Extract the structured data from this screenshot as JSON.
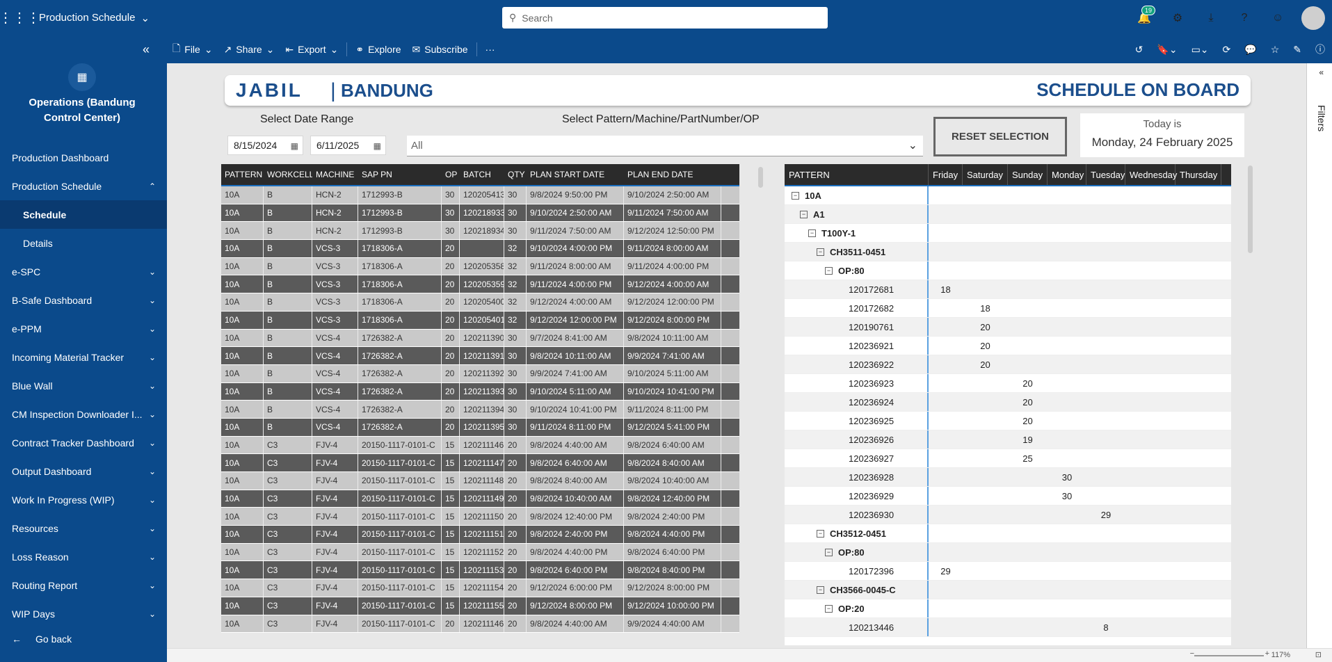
{
  "app": {
    "title": "Production Schedule",
    "search_placeholder": "Search",
    "notification_count": "19"
  },
  "sidebar": {
    "workspace_name": "Operations (Bandung Control Center)",
    "items": [
      {
        "label": "Production Dashboard",
        "chevron": false,
        "sub": false,
        "active": false
      },
      {
        "label": "Production Schedule",
        "chevron": true,
        "sub": false,
        "active": false,
        "expanded": true
      },
      {
        "label": "Schedule",
        "chevron": false,
        "sub": true,
        "active": true
      },
      {
        "label": "Details",
        "chevron": false,
        "sub": true,
        "active": false
      },
      {
        "label": "e-SPC",
        "chevron": true,
        "sub": false,
        "active": false
      },
      {
        "label": "B-Safe Dashboard",
        "chevron": true,
        "sub": false,
        "active": false
      },
      {
        "label": "e-PPM",
        "chevron": true,
        "sub": false,
        "active": false
      },
      {
        "label": "Incoming Material Tracker",
        "chevron": true,
        "sub": false,
        "active": false
      },
      {
        "label": "Blue Wall",
        "chevron": true,
        "sub": false,
        "active": false
      },
      {
        "label": "CM Inspection Downloader I...",
        "chevron": true,
        "sub": false,
        "active": false
      },
      {
        "label": "Contract Tracker Dashboard",
        "chevron": true,
        "sub": false,
        "active": false
      },
      {
        "label": "Output Dashboard",
        "chevron": true,
        "sub": false,
        "active": false
      },
      {
        "label": "Work In Progress (WIP)",
        "chevron": true,
        "sub": false,
        "active": false
      },
      {
        "label": "Resources",
        "chevron": true,
        "sub": false,
        "active": false
      },
      {
        "label": "Loss Reason",
        "chevron": true,
        "sub": false,
        "active": false
      },
      {
        "label": "Routing Report",
        "chevron": true,
        "sub": false,
        "active": false
      },
      {
        "label": "WIP Days",
        "chevron": true,
        "sub": false,
        "active": false
      }
    ],
    "go_back": "Go back"
  },
  "toolbar": {
    "file": "File",
    "share": "Share",
    "export": "Export",
    "explore": "Explore",
    "subscribe": "Subscribe",
    "more": "···"
  },
  "report": {
    "brand_left": "JABIL",
    "brand_right": "BANDUNG",
    "title": "SCHEDULE ON BOARD",
    "date_range_label": "Select Date Range",
    "date_from": "8/15/2024",
    "date_to": "6/11/2025",
    "filter_label": "Select Pattern/Machine/PartNumber/OP",
    "filter_value": "All",
    "reset_label": "RESET SELECTION",
    "today_label": "Today is",
    "today_value": "Monday, 24 February 2025",
    "filters_pane": "Filters",
    "zoom": "117%"
  },
  "schedule_table": {
    "columns": [
      "PATTERN",
      "WORKCELL",
      "MACHINE",
      "SAP PN",
      "OP",
      "BATCH",
      "QTY",
      "PLAN START DATE",
      "PLAN END DATE"
    ],
    "rows": [
      [
        "10A",
        "B",
        "HCN-2",
        "1712993-B",
        "30",
        "120205413",
        "30",
        "9/8/2024 9:50:00 PM",
        "9/10/2024 2:50:00 AM"
      ],
      [
        "10A",
        "B",
        "HCN-2",
        "1712993-B",
        "30",
        "120218933",
        "30",
        "9/10/2024 2:50:00 AM",
        "9/11/2024 7:50:00 AM"
      ],
      [
        "10A",
        "B",
        "HCN-2",
        "1712993-B",
        "30",
        "120218934",
        "30",
        "9/11/2024 7:50:00 AM",
        "9/12/2024 12:50:00 PM"
      ],
      [
        "10A",
        "B",
        "VCS-3",
        "1718306-A",
        "20",
        "",
        "32",
        "9/10/2024 4:00:00 PM",
        "9/11/2024 8:00:00 AM"
      ],
      [
        "10A",
        "B",
        "VCS-3",
        "1718306-A",
        "20",
        "120205358",
        "32",
        "9/11/2024 8:00:00 AM",
        "9/11/2024 4:00:00 PM"
      ],
      [
        "10A",
        "B",
        "VCS-3",
        "1718306-A",
        "20",
        "120205359",
        "32",
        "9/11/2024 4:00:00 PM",
        "9/12/2024 4:00:00 AM"
      ],
      [
        "10A",
        "B",
        "VCS-3",
        "1718306-A",
        "20",
        "120205400",
        "32",
        "9/12/2024 4:00:00 AM",
        "9/12/2024 12:00:00 PM"
      ],
      [
        "10A",
        "B",
        "VCS-3",
        "1718306-A",
        "20",
        "120205401",
        "32",
        "9/12/2024 12:00:00 PM",
        "9/12/2024 8:00:00 PM"
      ],
      [
        "10A",
        "B",
        "VCS-4",
        "1726382-A",
        "20",
        "120211390",
        "30",
        "9/7/2024 8:41:00 AM",
        "9/8/2024 10:11:00 AM"
      ],
      [
        "10A",
        "B",
        "VCS-4",
        "1726382-A",
        "20",
        "120211391",
        "30",
        "9/8/2024 10:11:00 AM",
        "9/9/2024 7:41:00 AM"
      ],
      [
        "10A",
        "B",
        "VCS-4",
        "1726382-A",
        "20",
        "120211392",
        "30",
        "9/9/2024 7:41:00 AM",
        "9/10/2024 5:11:00 AM"
      ],
      [
        "10A",
        "B",
        "VCS-4",
        "1726382-A",
        "20",
        "120211393",
        "30",
        "9/10/2024 5:11:00 AM",
        "9/10/2024 10:41:00 PM"
      ],
      [
        "10A",
        "B",
        "VCS-4",
        "1726382-A",
        "20",
        "120211394",
        "30",
        "9/10/2024 10:41:00 PM",
        "9/11/2024 8:11:00 PM"
      ],
      [
        "10A",
        "B",
        "VCS-4",
        "1726382-A",
        "20",
        "120211395",
        "30",
        "9/11/2024 8:11:00 PM",
        "9/12/2024 5:41:00 PM"
      ],
      [
        "10A",
        "C3",
        "FJV-4",
        "20150-1117-0101-C",
        "15",
        "120211146",
        "20",
        "9/8/2024 4:40:00 AM",
        "9/8/2024 6:40:00 AM"
      ],
      [
        "10A",
        "C3",
        "FJV-4",
        "20150-1117-0101-C",
        "15",
        "120211147",
        "20",
        "9/8/2024 6:40:00 AM",
        "9/8/2024 8:40:00 AM"
      ],
      [
        "10A",
        "C3",
        "FJV-4",
        "20150-1117-0101-C",
        "15",
        "120211148",
        "20",
        "9/8/2024 8:40:00 AM",
        "9/8/2024 10:40:00 AM"
      ],
      [
        "10A",
        "C3",
        "FJV-4",
        "20150-1117-0101-C",
        "15",
        "120211149",
        "20",
        "9/8/2024 10:40:00 AM",
        "9/8/2024 12:40:00 PM"
      ],
      [
        "10A",
        "C3",
        "FJV-4",
        "20150-1117-0101-C",
        "15",
        "120211150",
        "20",
        "9/8/2024 12:40:00 PM",
        "9/8/2024 2:40:00 PM"
      ],
      [
        "10A",
        "C3",
        "FJV-4",
        "20150-1117-0101-C",
        "15",
        "120211151",
        "20",
        "9/8/2024 2:40:00 PM",
        "9/8/2024 4:40:00 PM"
      ],
      [
        "10A",
        "C3",
        "FJV-4",
        "20150-1117-0101-C",
        "15",
        "120211152",
        "20",
        "9/8/2024 4:40:00 PM",
        "9/8/2024 6:40:00 PM"
      ],
      [
        "10A",
        "C3",
        "FJV-4",
        "20150-1117-0101-C",
        "15",
        "120211153",
        "20",
        "9/8/2024 6:40:00 PM",
        "9/8/2024 8:40:00 PM"
      ],
      [
        "10A",
        "C3",
        "FJV-4",
        "20150-1117-0101-C",
        "15",
        "120211154",
        "20",
        "9/12/2024 6:00:00 PM",
        "9/12/2024 8:00:00 PM"
      ],
      [
        "10A",
        "C3",
        "FJV-4",
        "20150-1117-0101-C",
        "15",
        "120211155",
        "20",
        "9/12/2024 8:00:00 PM",
        "9/12/2024 10:00:00 PM"
      ],
      [
        "10A",
        "C3",
        "FJV-4",
        "20150-1117-0101-C",
        "20",
        "120211146",
        "20",
        "9/8/2024 4:40:00 AM",
        "9/9/2024 4:40:00 AM"
      ]
    ]
  },
  "matrix": {
    "columns": [
      "PATTERN",
      "Friday",
      "Saturday",
      "Sunday",
      "Monday",
      "Tuesday",
      "Wednesday",
      "Thursday"
    ],
    "rows": [
      {
        "label": "10A",
        "level": 0,
        "group": true,
        "values": [
          "",
          "",
          "",
          "",
          "",
          "",
          ""
        ]
      },
      {
        "label": "A1",
        "level": 1,
        "group": true,
        "values": [
          "",
          "",
          "",
          "",
          "",
          "",
          ""
        ]
      },
      {
        "label": "T100Y-1",
        "level": 2,
        "group": true,
        "values": [
          "",
          "",
          "",
          "",
          "",
          "",
          ""
        ]
      },
      {
        "label": "CH3511-0451",
        "level": 3,
        "group": true,
        "values": [
          "",
          "",
          "",
          "",
          "",
          "",
          ""
        ]
      },
      {
        "label": "OP:80",
        "level": 4,
        "group": true,
        "values": [
          "",
          "",
          "",
          "",
          "",
          "",
          ""
        ]
      },
      {
        "label": "120172681",
        "level": 5,
        "group": false,
        "values": [
          "18",
          "",
          "",
          "",
          "",
          "",
          ""
        ]
      },
      {
        "label": "120172682",
        "level": 5,
        "group": false,
        "values": [
          "",
          "18",
          "",
          "",
          "",
          "",
          ""
        ]
      },
      {
        "label": "120190761",
        "level": 5,
        "group": false,
        "values": [
          "",
          "20",
          "",
          "",
          "",
          "",
          ""
        ]
      },
      {
        "label": "120236921",
        "level": 5,
        "group": false,
        "values": [
          "",
          "20",
          "",
          "",
          "",
          "",
          ""
        ]
      },
      {
        "label": "120236922",
        "level": 5,
        "group": false,
        "values": [
          "",
          "20",
          "",
          "",
          "",
          "",
          ""
        ]
      },
      {
        "label": "120236923",
        "level": 5,
        "group": false,
        "values": [
          "",
          "",
          "20",
          "",
          "",
          "",
          ""
        ]
      },
      {
        "label": "120236924",
        "level": 5,
        "group": false,
        "values": [
          "",
          "",
          "20",
          "",
          "",
          "",
          ""
        ]
      },
      {
        "label": "120236925",
        "level": 5,
        "group": false,
        "values": [
          "",
          "",
          "20",
          "",
          "",
          "",
          ""
        ]
      },
      {
        "label": "120236926",
        "level": 5,
        "group": false,
        "values": [
          "",
          "",
          "19",
          "",
          "",
          "",
          ""
        ]
      },
      {
        "label": "120236927",
        "level": 5,
        "group": false,
        "values": [
          "",
          "",
          "25",
          "",
          "",
          "",
          ""
        ]
      },
      {
        "label": "120236928",
        "level": 5,
        "group": false,
        "values": [
          "",
          "",
          "",
          "30",
          "",
          "",
          ""
        ]
      },
      {
        "label": "120236929",
        "level": 5,
        "group": false,
        "values": [
          "",
          "",
          "",
          "30",
          "",
          "",
          ""
        ]
      },
      {
        "label": "120236930",
        "level": 5,
        "group": false,
        "values": [
          "",
          "",
          "",
          "",
          "29",
          "",
          ""
        ]
      },
      {
        "label": "CH3512-0451",
        "level": 3,
        "group": true,
        "values": [
          "",
          "",
          "",
          "",
          "",
          "",
          ""
        ]
      },
      {
        "label": "OP:80",
        "level": 4,
        "group": true,
        "values": [
          "",
          "",
          "",
          "",
          "",
          "",
          ""
        ]
      },
      {
        "label": "120172396",
        "level": 5,
        "group": false,
        "values": [
          "29",
          "",
          "",
          "",
          "",
          "",
          ""
        ]
      },
      {
        "label": "CH3566-0045-C",
        "level": 3,
        "group": true,
        "values": [
          "",
          "",
          "",
          "",
          "",
          "",
          ""
        ]
      },
      {
        "label": "OP:20",
        "level": 4,
        "group": true,
        "values": [
          "",
          "",
          "",
          "",
          "",
          "",
          ""
        ]
      },
      {
        "label": "120213446",
        "level": 5,
        "group": false,
        "values": [
          "",
          "",
          "",
          "",
          "8",
          "",
          ""
        ]
      }
    ]
  }
}
